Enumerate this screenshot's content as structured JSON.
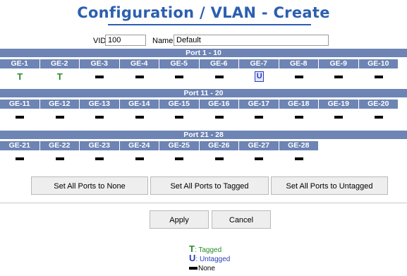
{
  "page": {
    "title": "Configuration / VLAN - Create"
  },
  "form": {
    "vid_label": "VID",
    "vid_value": "100",
    "name_label": "Name",
    "name_value": "Default"
  },
  "groups": [
    {
      "header": "Port 1 - 10",
      "ports": [
        {
          "label": "GE-1",
          "state": "T"
        },
        {
          "label": "GE-2",
          "state": "T"
        },
        {
          "label": "GE-3",
          "state": "none"
        },
        {
          "label": "GE-4",
          "state": "none"
        },
        {
          "label": "GE-5",
          "state": "none"
        },
        {
          "label": "GE-6",
          "state": "none"
        },
        {
          "label": "GE-7",
          "state": "U"
        },
        {
          "label": "GE-8",
          "state": "none"
        },
        {
          "label": "GE-9",
          "state": "none"
        },
        {
          "label": "GE-10",
          "state": "none"
        }
      ]
    },
    {
      "header": "Port 11 - 20",
      "ports": [
        {
          "label": "GE-11",
          "state": "none"
        },
        {
          "label": "GE-12",
          "state": "none"
        },
        {
          "label": "GE-13",
          "state": "none"
        },
        {
          "label": "GE-14",
          "state": "none"
        },
        {
          "label": "GE-15",
          "state": "none"
        },
        {
          "label": "GE-16",
          "state": "none"
        },
        {
          "label": "GE-17",
          "state": "none"
        },
        {
          "label": "GE-18",
          "state": "none"
        },
        {
          "label": "GE-19",
          "state": "none"
        },
        {
          "label": "GE-20",
          "state": "none"
        }
      ]
    },
    {
      "header": "Port 21 - 28",
      "ports": [
        {
          "label": "GE-21",
          "state": "none"
        },
        {
          "label": "GE-22",
          "state": "none"
        },
        {
          "label": "GE-23",
          "state": "none"
        },
        {
          "label": "GE-24",
          "state": "none"
        },
        {
          "label": "GE-25",
          "state": "none"
        },
        {
          "label": "GE-26",
          "state": "none"
        },
        {
          "label": "GE-27",
          "state": "none"
        },
        {
          "label": "GE-28",
          "state": "none"
        }
      ]
    }
  ],
  "bulk_buttons": {
    "none": "Set All Ports to None",
    "tagged": "Set All Ports to Tagged",
    "untagged": "Set All Ports to Untagged"
  },
  "actions": {
    "apply": "Apply",
    "cancel": "Cancel"
  },
  "legend": {
    "t_symbol": "T",
    "tagged": ": Tagged",
    "u_symbol": "U",
    "untagged": ": Untagged",
    "none": "None"
  },
  "colors": {
    "header_bg": "#6d84b4",
    "title": "#2c5fb0",
    "tagged": "#2a8a2a",
    "untagged": "#2d3eb8"
  }
}
